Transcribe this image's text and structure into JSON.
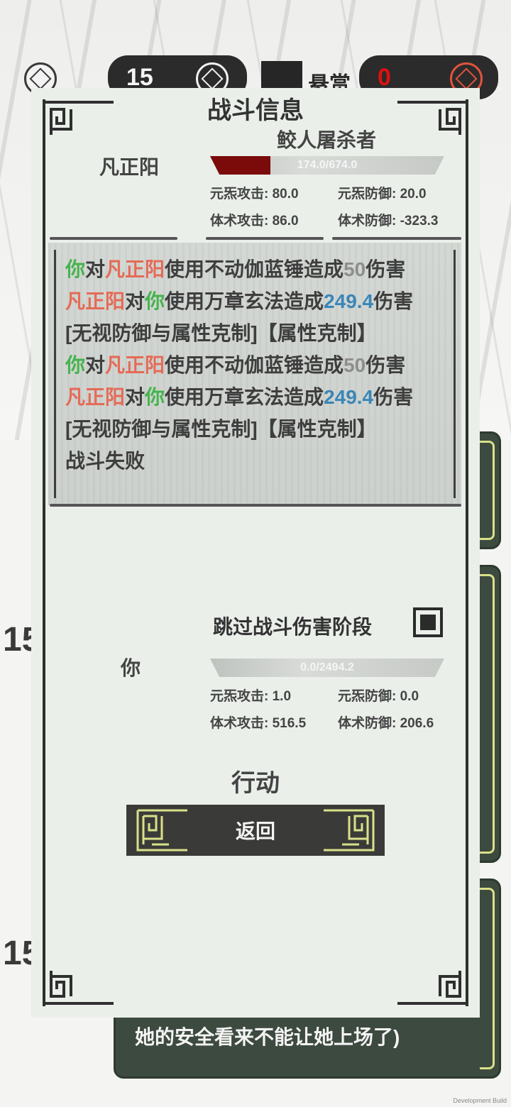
{
  "topbar": {
    "counter_value": "15",
    "bounty_label": "悬赏",
    "bounty_value": "0"
  },
  "background": {
    "row_number_1": "15",
    "row_number_2": "15",
    "bottom_card_text": "她的安全看来不能让她上场了)"
  },
  "dialog": {
    "title": "战斗信息",
    "enemy": {
      "title": "鲛人屠杀者",
      "name": "凡正阳",
      "hp_text": "174.0/674.0",
      "hp_fraction": 0.258,
      "stats": {
        "yuan_atk": "元炁攻击: 80.0",
        "yuan_def": "元炁防御: 20.0",
        "ti_atk": "体术攻击: 86.0",
        "ti_def": "体术防御: -323.3"
      }
    },
    "log": {
      "line1": [
        "你",
        "对",
        "凡正阳",
        "使用不动伽蓝锤造成",
        "50",
        "伤害"
      ],
      "line2": [
        "凡正阳",
        "对",
        "你",
        "使用万章玄法造成",
        "249.4",
        "伤害"
      ],
      "line3": "[无视防御与属性克制]【属性克制】",
      "line4": [
        "你",
        "对",
        "凡正阳",
        "使用不动伽蓝锤造成",
        "50",
        "伤害"
      ],
      "line5": [
        "凡正阳",
        "对",
        "你",
        "使用万章玄法造成",
        "249.4",
        "伤害"
      ],
      "line6": "[无视防御与属性克制]【属性克制】",
      "line7": "战斗失败"
    },
    "skip_label": "跳过战斗伤害阶段",
    "skip_checked": true,
    "player": {
      "name": "你",
      "hp_text": "0.0/2494.2",
      "hp_fraction": 0.0,
      "stats": {
        "yuan_atk": "元炁攻击: 1.0",
        "yuan_def": "元炁防御: 0.0",
        "ti_atk": "体术攻击: 516.5",
        "ti_def": "体术防御: 206.6"
      }
    },
    "action_label": "行动",
    "return_label": "返回"
  },
  "footer": {
    "dev_build": "Development Build"
  },
  "colors": {
    "dialog_bg": "#eaefea",
    "hp_fill": "#7b0a0a",
    "attacker_green": "#45b34e",
    "enemy_red": "#e46b57",
    "damage_blue": "#3a86b8",
    "button_bg": "#3a3b38",
    "accent_gold": "#d9e08a"
  }
}
